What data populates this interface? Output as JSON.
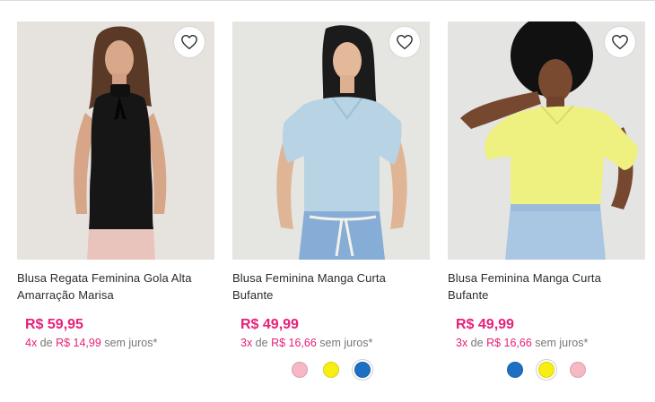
{
  "products": [
    {
      "name": "Blusa Regata Feminina Gola Alta Amarração Marisa",
      "price": "R$ 59,95",
      "installments": {
        "count": "4x",
        "prefix": " de ",
        "value": "R$ 14,99",
        "suffix": " sem juros*"
      },
      "photo_bg": "#e6e3df",
      "colors": []
    },
    {
      "name": "Blusa Feminina Manga Curta Bufante",
      "price": "R$ 49,99",
      "installments": {
        "count": "3x",
        "prefix": " de ",
        "value": "R$ 16,66",
        "suffix": " sem juros*"
      },
      "photo_bg": "#e5e5e2",
      "colors": [
        {
          "name": "pink",
          "hex": "#f5b8c4",
          "selected": false
        },
        {
          "name": "yellow",
          "hex": "#f7ef12",
          "selected": false
        },
        {
          "name": "blue",
          "hex": "#1d6fc4",
          "selected": true
        }
      ]
    },
    {
      "name": "Blusa Feminina Manga Curta Bufante",
      "price": "R$ 49,99",
      "installments": {
        "count": "3x",
        "prefix": " de ",
        "value": "R$ 16,66",
        "suffix": " sem juros*"
      },
      "photo_bg": "#e4e4e2",
      "colors": [
        {
          "name": "blue",
          "hex": "#1d6fc4",
          "selected": false
        },
        {
          "name": "yellow",
          "hex": "#f7ef12",
          "selected": true
        },
        {
          "name": "pink",
          "hex": "#f5b8c4",
          "selected": false
        }
      ]
    }
  ],
  "accent_color": "#e8207a"
}
